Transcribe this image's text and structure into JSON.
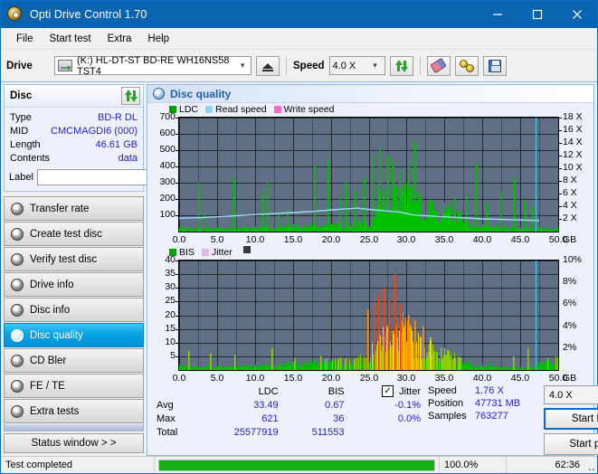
{
  "window": {
    "title": "Opti Drive Control 1.70",
    "icon": "disc-icon",
    "minimize": "minimize-icon",
    "maximize": "maximize-icon",
    "close": "close-icon"
  },
  "menu": {
    "items": [
      "File",
      "Start test",
      "Extra",
      "Help"
    ]
  },
  "toolbar": {
    "drive_label": "Drive",
    "drive_value": "(K:)  HL-DT-ST BD-RE  WH16NS58 TST4",
    "eject_icon": "eject-icon",
    "speed_label": "Speed",
    "speed_value": "4.0 X",
    "refresh_icon": "refresh-icon",
    "erase_icon": "eraser-icon",
    "gold_icon": "gold-discs-icon",
    "save_icon": "save-icon"
  },
  "disc": {
    "title": "Disc",
    "refresh_icon": "refresh-icon",
    "rows": [
      {
        "key": "Type",
        "value": "BD-R DL"
      },
      {
        "key": "MID",
        "value": "CMCMAGDI6 (000)"
      },
      {
        "key": "Length",
        "value": "46.61 GB"
      },
      {
        "key": "Contents",
        "value": "data"
      }
    ],
    "label_key": "Label",
    "label_value": "",
    "label_placeholder": "",
    "disc_button_icon": "disc-icon"
  },
  "sidebar": {
    "items": [
      {
        "label": "Transfer rate",
        "active": false
      },
      {
        "label": "Create test disc",
        "active": false
      },
      {
        "label": "Verify test disc",
        "active": false
      },
      {
        "label": "Drive info",
        "active": false
      },
      {
        "label": "Disc info",
        "active": false
      },
      {
        "label": "Disc quality",
        "active": true
      },
      {
        "label": "CD Bler",
        "active": false
      },
      {
        "label": "FE / TE",
        "active": false
      },
      {
        "label": "Extra tests",
        "active": false
      }
    ],
    "status_button": "Status window > >"
  },
  "panel": {
    "title": "Disc quality",
    "icon": "disc-quality-icon"
  },
  "chart_data": [
    {
      "type": "area",
      "id": "ldc-chart",
      "title": "",
      "xlabel": "GB",
      "ylabel": "",
      "legend": [
        {
          "name": "LDC",
          "color": "#00a000"
        },
        {
          "name": "Read speed",
          "color": "#8fd6f5"
        },
        {
          "name": "Write speed",
          "color": "#ff66d0"
        }
      ],
      "legend_position": "top-left",
      "grid": true,
      "x": [
        0.0,
        5.0,
        10.0,
        15.0,
        20.0,
        25.0,
        30.0,
        35.0,
        40.0,
        45.0,
        50.0
      ],
      "xlim": [
        0.0,
        50.0
      ],
      "xtick_labels": [
        "0.0",
        "5.0",
        "10.0",
        "15.0",
        "20.0",
        "25.0",
        "30.0",
        "35.0",
        "40.0",
        "45.0",
        "50.0"
      ],
      "x_unit": "GB",
      "ylim": [
        0,
        700
      ],
      "ytick_labels": [
        "100",
        "200",
        "300",
        "400",
        "500",
        "600",
        "700"
      ],
      "y2lim": [
        0,
        18
      ],
      "y2tick_labels": [
        "2 X",
        "4 X",
        "6 X",
        "8 X",
        "10 X",
        "12 X",
        "14 X",
        "16 X",
        "18 X"
      ],
      "series": [
        {
          "name": "LDC",
          "color": "#00c000",
          "envelope": [
            28,
            22,
            26,
            20,
            24,
            18,
            22,
            26,
            20,
            24,
            22,
            26,
            20,
            24,
            28,
            22,
            26,
            24,
            30,
            26,
            28,
            24,
            30,
            26,
            32,
            28,
            34,
            30,
            36,
            32,
            38,
            34,
            40,
            36,
            42,
            38,
            44,
            40,
            46,
            42,
            48,
            44,
            50,
            46,
            52,
            48,
            56,
            52,
            60,
            56,
            64,
            150,
            210,
            230,
            240,
            250,
            245,
            235,
            250,
            260,
            230,
            210,
            200,
            190,
            180,
            170,
            160,
            150,
            145,
            140,
            135,
            130,
            125,
            120,
            115,
            60,
            45,
            40,
            38,
            36,
            34,
            32,
            30,
            28,
            30,
            28,
            26,
            28,
            26,
            24,
            26,
            24,
            22,
            24,
            22,
            20,
            22,
            24,
            26,
            30
          ],
          "spikes": [
            {
              "x": 2.5,
              "y": 300
            },
            {
              "x": 3.2,
              "y": 110
            },
            {
              "x": 7.2,
              "y": 330
            },
            {
              "x": 11.0,
              "y": 240
            },
            {
              "x": 11.6,
              "y": 310
            },
            {
              "x": 13.0,
              "y": 120
            },
            {
              "x": 14.2,
              "y": 140
            },
            {
              "x": 17.8,
              "y": 410
            },
            {
              "x": 19.6,
              "y": 440
            },
            {
              "x": 21.1,
              "y": 230
            },
            {
              "x": 22.0,
              "y": 300
            },
            {
              "x": 23.2,
              "y": 250
            },
            {
              "x": 24.3,
              "y": 330
            },
            {
              "x": 25.4,
              "y": 480
            },
            {
              "x": 26.4,
              "y": 520
            },
            {
              "x": 27.5,
              "y": 470
            },
            {
              "x": 28.2,
              "y": 430
            },
            {
              "x": 29.0,
              "y": 380
            },
            {
              "x": 30.2,
              "y": 420
            },
            {
              "x": 31.0,
              "y": 560
            },
            {
              "x": 33.0,
              "y": 190
            },
            {
              "x": 34.7,
              "y": 150
            },
            {
              "x": 36.3,
              "y": 200
            },
            {
              "x": 37.8,
              "y": 230
            },
            {
              "x": 39.2,
              "y": 420
            },
            {
              "x": 40.6,
              "y": 180
            },
            {
              "x": 42.4,
              "y": 250
            },
            {
              "x": 44.2,
              "y": 330
            },
            {
              "x": 45.6,
              "y": 190
            },
            {
              "x": 46.5,
              "y": 150
            }
          ]
        },
        {
          "name": "Read speed",
          "color": "#9fdcf8",
          "axis": "right",
          "points": [
            {
              "x": 0.0,
              "y": 2.1
            },
            {
              "x": 3.0,
              "y": 2.2
            },
            {
              "x": 6.0,
              "y": 2.4
            },
            {
              "x": 9.0,
              "y": 2.6
            },
            {
              "x": 12.0,
              "y": 2.8
            },
            {
              "x": 15.0,
              "y": 3.0
            },
            {
              "x": 18.0,
              "y": 3.2
            },
            {
              "x": 21.0,
              "y": 3.5
            },
            {
              "x": 23.5,
              "y": 3.7
            },
            {
              "x": 25.0,
              "y": 3.5
            },
            {
              "x": 27.0,
              "y": 3.3
            },
            {
              "x": 29.0,
              "y": 3.1
            },
            {
              "x": 31.0,
              "y": 2.6
            },
            {
              "x": 34.0,
              "y": 2.4
            },
            {
              "x": 37.0,
              "y": 2.2
            },
            {
              "x": 40.0,
              "y": 2.0
            },
            {
              "x": 43.0,
              "y": 1.9
            },
            {
              "x": 46.0,
              "y": 1.8
            },
            {
              "x": 47.5,
              "y": 1.76
            }
          ]
        }
      ],
      "cursor_x": 47.0
    },
    {
      "type": "area",
      "id": "bis-chart",
      "title": "",
      "xlabel": "GB",
      "legend": [
        {
          "name": "BIS",
          "color": "#00a000"
        },
        {
          "name": "Jitter",
          "color": "#e3b9e8"
        }
      ],
      "legend_position": "top-left",
      "grid": true,
      "xlim": [
        0.0,
        50.0
      ],
      "xtick_labels": [
        "0.0",
        "5.0",
        "10.0",
        "15.0",
        "20.0",
        "25.0",
        "30.0",
        "35.0",
        "40.0",
        "45.0",
        "50.0"
      ],
      "x_unit": "GB",
      "ylim": [
        0,
        40
      ],
      "ytick_labels": [
        "5",
        "10",
        "15",
        "20",
        "25",
        "30",
        "35",
        "40"
      ],
      "y2lim": [
        0,
        10
      ],
      "y2tick_labels": [
        "2%",
        "4%",
        "6%",
        "8%",
        "10%"
      ],
      "series": [
        {
          "name": "BIS",
          "color_low": "#00c000",
          "color_mid": "#ffd000",
          "color_high": "#ff4000",
          "envelope": [
            2.0,
            1.4,
            1.8,
            1.2,
            1.6,
            1.0,
            1.5,
            1.8,
            1.2,
            1.6,
            1.3,
            1.7,
            1.1,
            1.5,
            1.9,
            1.3,
            1.7,
            1.4,
            2.0,
            1.6,
            1.8,
            1.4,
            2.0,
            1.6,
            2.2,
            1.8,
            2.4,
            2.0,
            2.6,
            2.2,
            2.8,
            2.4,
            3.0,
            2.6,
            3.2,
            2.8,
            3.4,
            3.0,
            3.6,
            3.2,
            3.8,
            3.4,
            4.0,
            3.6,
            4.2,
            3.8,
            4.6,
            4.2,
            5.0,
            4.6,
            6.0,
            10.0,
            13.0,
            14.0,
            15.0,
            16.0,
            15.0,
            14.0,
            16.0,
            17.0,
            14.0,
            12.0,
            11.0,
            10.5,
            10.0,
            9.0,
            8.5,
            8.0,
            7.0,
            6.5,
            6.0,
            5.5,
            5.0,
            4.5,
            4.0,
            2.5,
            2.0,
            1.8,
            1.6,
            1.5,
            1.4,
            1.3,
            1.2,
            1.1,
            1.3,
            1.2,
            1.1,
            1.2,
            1.1,
            1.0,
            1.2,
            1.1,
            1.4,
            1.8,
            2.4,
            3.0,
            3.6,
            4.2,
            5.0,
            6.0
          ],
          "spikes": [
            {
              "x": 1.2,
              "y": 7.0
            },
            {
              "x": 4.1,
              "y": 6.0
            },
            {
              "x": 7.3,
              "y": 5.5
            },
            {
              "x": 12.2,
              "y": 8.0
            },
            {
              "x": 15.1,
              "y": 4.5
            },
            {
              "x": 18.6,
              "y": 5.0
            },
            {
              "x": 21.3,
              "y": 4.0
            },
            {
              "x": 24.8,
              "y": 22.0
            },
            {
              "x": 25.6,
              "y": 25.0
            },
            {
              "x": 26.2,
              "y": 28.0
            },
            {
              "x": 27.0,
              "y": 30.0
            },
            {
              "x": 27.6,
              "y": 26.0
            },
            {
              "x": 28.4,
              "y": 35.0
            },
            {
              "x": 29.1,
              "y": 24.0
            },
            {
              "x": 30.2,
              "y": 20.0
            },
            {
              "x": 31.0,
              "y": 18.0
            },
            {
              "x": 32.1,
              "y": 16.0
            },
            {
              "x": 33.0,
              "y": 12.0
            },
            {
              "x": 34.5,
              "y": 8.0
            },
            {
              "x": 36.0,
              "y": 4.0
            },
            {
              "x": 38.2,
              "y": 3.5
            },
            {
              "x": 41.0,
              "y": 3.0
            },
            {
              "x": 44.0,
              "y": 5.0
            },
            {
              "x": 46.0,
              "y": 8.0
            }
          ]
        }
      ],
      "cursor_x": 47.0
    }
  ],
  "stats": {
    "columns": [
      "",
      "LDC",
      "BIS",
      "Jitter"
    ],
    "jitter_checked": true,
    "jitter_checkmark": "✓",
    "rows": [
      {
        "label": "Avg",
        "ldc": "33.49",
        "bis": "0.67",
        "jitter": "-0.1%"
      },
      {
        "label": "Max",
        "ldc": "621",
        "bis": "36",
        "jitter": "0.0%"
      },
      {
        "label": "Total",
        "ldc": "25577919",
        "bis": "511553",
        "jitter": ""
      }
    ]
  },
  "readout": {
    "speed_label": "Speed",
    "speed_value": "1.76 X",
    "position_label": "Position",
    "position_value": "47731 MB",
    "samples_label": "Samples",
    "samples_value": "763277"
  },
  "actions": {
    "speed_select": "4.0 X",
    "start_full": "Start full",
    "start_part": "Start part"
  },
  "statusbar": {
    "message": "Test completed",
    "progress_percent": "100.0%",
    "progress_value": 100,
    "elapsed": "62:36"
  },
  "colors": {
    "accent": "#0a64b0",
    "plot_bg": "#5f6f86",
    "ldc_green": "#00c000",
    "read_speed": "#9fdcf8",
    "write_speed": "#ff66d0",
    "jitter": "#e3b9e8",
    "value_text": "#2222cc",
    "progress": "#14b014"
  }
}
